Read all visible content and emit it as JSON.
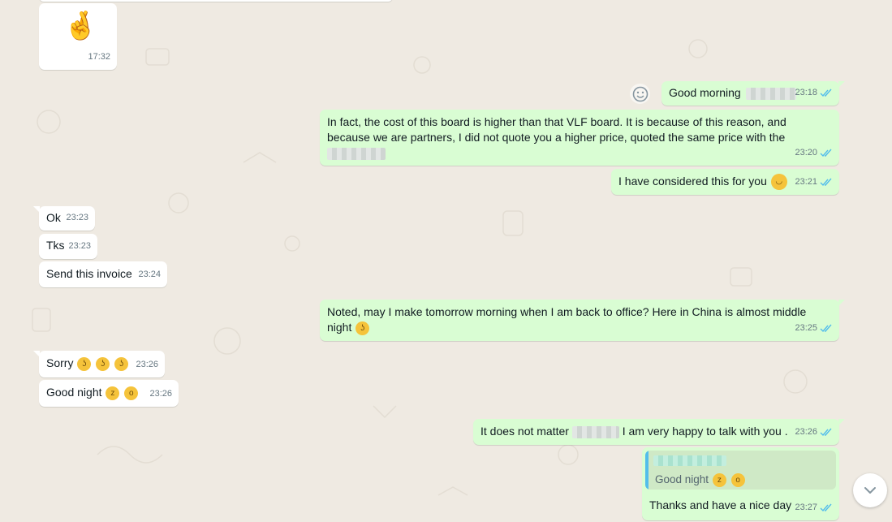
{
  "colors": {
    "background": "#efeae2",
    "incoming_bubble": "#ffffff",
    "outgoing_bubble": "#d9fdd3",
    "read_ticks": "#53bdeb",
    "timestamp": "#667781"
  },
  "messages": [
    {
      "id": "m1",
      "dir": "in",
      "content": "🤞",
      "time": "17:32"
    },
    {
      "id": "m2",
      "dir": "out",
      "text": "Good morning",
      "time": "23:18",
      "status": "read"
    },
    {
      "id": "m3",
      "dir": "out",
      "text": "In fact, the cost of this board is higher than that VLF board. It is because of this reason, and because we are partners, I did not quote you a higher price, quoted the same price with the",
      "time": "23:20",
      "status": "read"
    },
    {
      "id": "m4",
      "dir": "out",
      "text": "I have considered this for you",
      "time": "23:21",
      "status": "read"
    },
    {
      "id": "m5",
      "dir": "in",
      "text": "Ok",
      "time": "23:23"
    },
    {
      "id": "m6",
      "dir": "in",
      "text": "Tks",
      "time": "23:23"
    },
    {
      "id": "m7",
      "dir": "in",
      "text": "Send this invoice",
      "time": "23:24"
    },
    {
      "id": "m8",
      "dir": "out",
      "text": "Noted, may I make tomorrow morning when I am back to office? Here in China is almost middle night",
      "time": "23:25",
      "status": "read"
    },
    {
      "id": "m9",
      "dir": "in",
      "text": "Sorry",
      "time": "23:26"
    },
    {
      "id": "m10",
      "dir": "in",
      "text": "Good night",
      "time": "23:26"
    },
    {
      "id": "m11",
      "dir": "out",
      "text_before": "It does not matter",
      "text_after": "I am very happy to talk with you .",
      "time": "23:26",
      "status": "read"
    },
    {
      "id": "m12",
      "dir": "out",
      "quoted_text": "Good night",
      "text": "Thanks and have a nice day",
      "time": "23:27",
      "status": "read"
    }
  ],
  "icons": {
    "react": "smiley-icon",
    "scroll": "chevron-down-icon",
    "ticks": "double-check-icon"
  }
}
